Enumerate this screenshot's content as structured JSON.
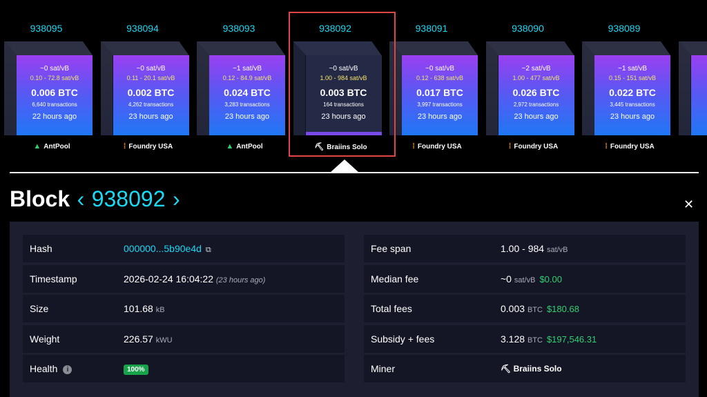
{
  "blocks": [
    {
      "height": "938095",
      "fee": "~0 sat/vB",
      "span": "0.10 - 72.8 sat/vB",
      "btc": "0.006 BTC",
      "tx": "6,640 transactions",
      "ago": "22 hours ago",
      "pool": "AntPool",
      "pool_icon": "antpool-icon"
    },
    {
      "height": "938094",
      "fee": "~0 sat/vB",
      "span": "0.11 - 20.1 sat/vB",
      "btc": "0.002 BTC",
      "tx": "4,262 transactions",
      "ago": "23 hours ago",
      "pool": "Foundry USA",
      "pool_icon": "foundry-icon"
    },
    {
      "height": "938093",
      "fee": "~1 sat/vB",
      "span": "0.12 - 84.9 sat/vB",
      "btc": "0.024 BTC",
      "tx": "3,283 transactions",
      "ago": "23 hours ago",
      "pool": "AntPool",
      "pool_icon": "antpool-icon"
    },
    {
      "height": "938092",
      "fee": "~0 sat/vB",
      "span": "1.00 - 984 sat/vB",
      "btc": "0.003 BTC",
      "tx": "164 transactions",
      "ago": "23 hours ago",
      "pool": "Braiins Solo",
      "pool_icon": "pickaxe-icon"
    },
    {
      "height": "938091",
      "fee": "~0 sat/vB",
      "span": "0.12 - 638 sat/vB",
      "btc": "0.017 BTC",
      "tx": "3,997 transactions",
      "ago": "23 hours ago",
      "pool": "Foundry USA",
      "pool_icon": "foundry-icon"
    },
    {
      "height": "938090",
      "fee": "~2 sat/vB",
      "span": "1.00 - 477 sat/vB",
      "btc": "0.026 BTC",
      "tx": "2,972 transactions",
      "ago": "23 hours ago",
      "pool": "Foundry USA",
      "pool_icon": "foundry-icon"
    },
    {
      "height": "938089",
      "fee": "~1 sat/vB",
      "span": "0.15 - 151 sat/vB",
      "btc": "0.022 BTC",
      "tx": "3,445 transactions",
      "ago": "23 hours ago",
      "pool": "Foundry USA",
      "pool_icon": "foundry-icon"
    }
  ],
  "header": {
    "label": "Block",
    "prev": "‹",
    "height": "938092",
    "next": "›",
    "close": "✕"
  },
  "details_left": {
    "hash": {
      "label": "Hash",
      "value": "000000...5b90e4d"
    },
    "timestamp": {
      "label": "Timestamp",
      "value": "2026-02-24 16:04:22",
      "ago": "(23 hours ago)"
    },
    "size": {
      "label": "Size",
      "value": "101.68",
      "unit": "kB"
    },
    "weight": {
      "label": "Weight",
      "value": "226.57",
      "unit": "kWU"
    },
    "health": {
      "label": "Health",
      "value": "100%"
    }
  },
  "details_right": {
    "fee_span": {
      "label": "Fee span",
      "value": "1.00 - 984",
      "unit": "sat/vB"
    },
    "median_fee": {
      "label": "Median fee",
      "value": "~0",
      "unit": "sat/vB",
      "usd": "$0.00"
    },
    "total_fees": {
      "label": "Total fees",
      "value": "0.003",
      "unit": "BTC",
      "usd": "$180.68"
    },
    "subsidy": {
      "label": "Subsidy + fees",
      "value": "3.128",
      "unit": "BTC",
      "usd": "$197,546.31"
    },
    "miner": {
      "label": "Miner",
      "value": "Braiins Solo"
    }
  },
  "colors": {
    "accent": "#1bd8f4",
    "usd": "#2fd072",
    "selected": "#e04545"
  }
}
